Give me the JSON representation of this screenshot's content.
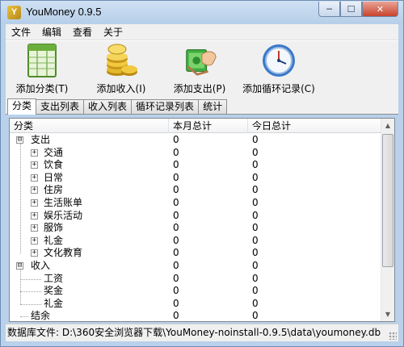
{
  "window": {
    "title": "YouMoney 0.9.5",
    "app_icon": "Y",
    "controls": [
      "─",
      "☐",
      "✕"
    ]
  },
  "menu": [
    "文件",
    "编辑",
    "查看",
    "关于"
  ],
  "toolbar": [
    {
      "label": "添加分类(T)",
      "icon": "ledger-icon"
    },
    {
      "label": "添加收入(I)",
      "icon": "coins-icon"
    },
    {
      "label": "添加支出(P)",
      "icon": "money-hand-icon"
    },
    {
      "label": "添加循环记录(C)",
      "icon": "clock-icon"
    }
  ],
  "tabs": [
    "分类",
    "支出列表",
    "收入列表",
    "循环记录列表",
    "统计"
  ],
  "active_tab": "分类",
  "table": {
    "headers": [
      "分类",
      "本月总计",
      "今日总计"
    ],
    "rows": [
      {
        "name": "支出",
        "level": 0,
        "toggle": "⊟",
        "month": "0",
        "today": "0"
      },
      {
        "name": "交通",
        "level": 1,
        "toggle": "+",
        "month": "0",
        "today": "0"
      },
      {
        "name": "饮食",
        "level": 1,
        "toggle": "+",
        "month": "0",
        "today": "0"
      },
      {
        "name": "日常",
        "level": 1,
        "toggle": "+",
        "month": "0",
        "today": "0"
      },
      {
        "name": "住房",
        "level": 1,
        "toggle": "+",
        "month": "0",
        "today": "0"
      },
      {
        "name": "生活账单",
        "level": 1,
        "toggle": "+",
        "month": "0",
        "today": "0"
      },
      {
        "name": "娱乐活动",
        "level": 1,
        "toggle": "+",
        "month": "0",
        "today": "0"
      },
      {
        "name": "服饰",
        "level": 1,
        "toggle": "+",
        "month": "0",
        "today": "0"
      },
      {
        "name": "礼金",
        "level": 1,
        "toggle": "+",
        "month": "0",
        "today": "0"
      },
      {
        "name": "文化教育",
        "level": 1,
        "toggle": "+",
        "month": "0",
        "today": "0"
      },
      {
        "name": "收入",
        "level": 0,
        "toggle": "⊟",
        "month": "0",
        "today": "0"
      },
      {
        "name": "工资",
        "level": 1,
        "toggle": "",
        "month": "0",
        "today": "0"
      },
      {
        "name": "奖金",
        "level": 1,
        "toggle": "",
        "month": "0",
        "today": "0"
      },
      {
        "name": "礼金",
        "level": 1,
        "toggle": "",
        "month": "0",
        "today": "0"
      },
      {
        "name": "结余",
        "level": 0,
        "toggle": "",
        "month": "0",
        "today": "0"
      }
    ]
  },
  "status": {
    "text": "数据库文件: D:\\360安全浏览器下载\\YouMoney-noinstall-0.9.5\\data\\youmoney.db"
  },
  "colors": {
    "titlebar": "#c3d7ee",
    "close": "#c8442e",
    "chrome": "#f0f0f0"
  }
}
